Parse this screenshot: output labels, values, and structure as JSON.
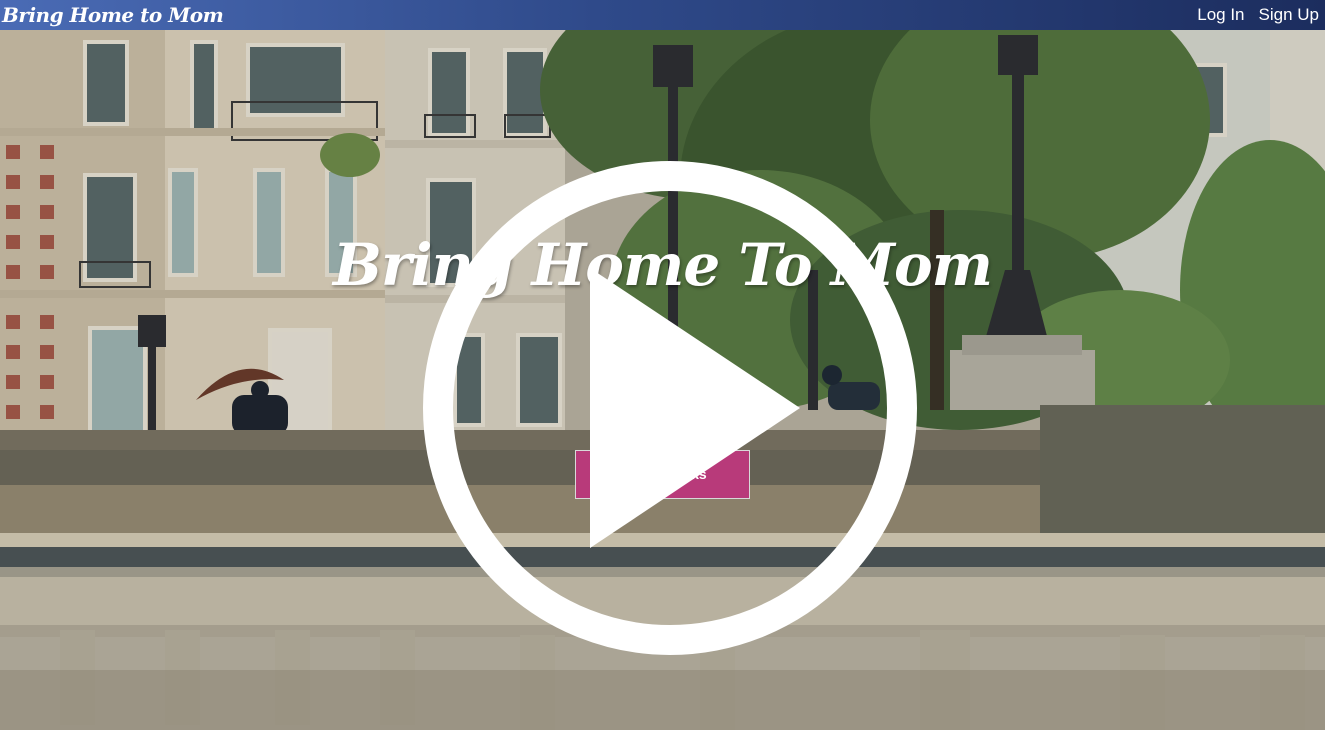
{
  "navbar": {
    "brand": "Bring Home to Mom",
    "login_label": "Log In",
    "signup_label": "Sign Up"
  },
  "hero": {
    "title": "Bring Home To Mom",
    "cta_label": "How It Works"
  },
  "icons": {
    "play": "play-icon"
  },
  "colors": {
    "navbar_start": "#4a6bb5",
    "navbar_end": "#1c2d5e",
    "cta_background": "#b83a7a",
    "play_icon": "#ffffff"
  }
}
